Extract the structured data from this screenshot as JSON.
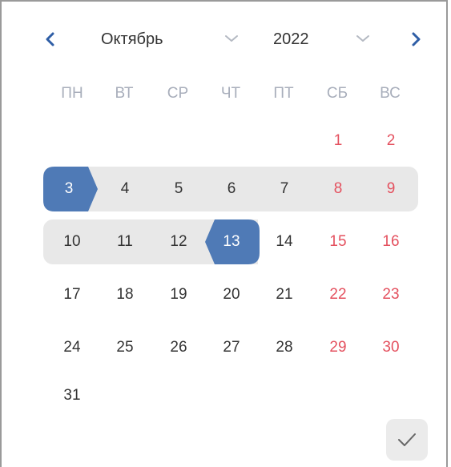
{
  "header": {
    "prev_icon": "chevron-left-icon",
    "next_icon": "chevron-right-icon",
    "month": "Октябрь",
    "year": "2022",
    "accent_color": "#2f5ea6"
  },
  "weekdays": [
    "ПН",
    "ВТ",
    "СР",
    "ЧТ",
    "ПТ",
    "СБ",
    "ВС"
  ],
  "weeks": [
    [
      "",
      "",
      "",
      "",
      "",
      "1",
      "2"
    ],
    [
      "3",
      "4",
      "5",
      "6",
      "7",
      "8",
      "9"
    ],
    [
      "10",
      "11",
      "12",
      "13",
      "14",
      "15",
      "16"
    ],
    [
      "17",
      "18",
      "19",
      "20",
      "21",
      "22",
      "23"
    ],
    [
      "24",
      "25",
      "26",
      "27",
      "28",
      "29",
      "30"
    ],
    [
      "31",
      "",
      "",
      "",
      "",
      "",
      ""
    ]
  ],
  "range": {
    "start": "3",
    "end": "13"
  },
  "colors": {
    "weekend": "#e4515f",
    "selected_bg": "#4f7ab6",
    "range_bg": "#e8e8e8",
    "weekday_header": "#a8aebb"
  },
  "confirm": {
    "icon": "checkmark-icon"
  }
}
